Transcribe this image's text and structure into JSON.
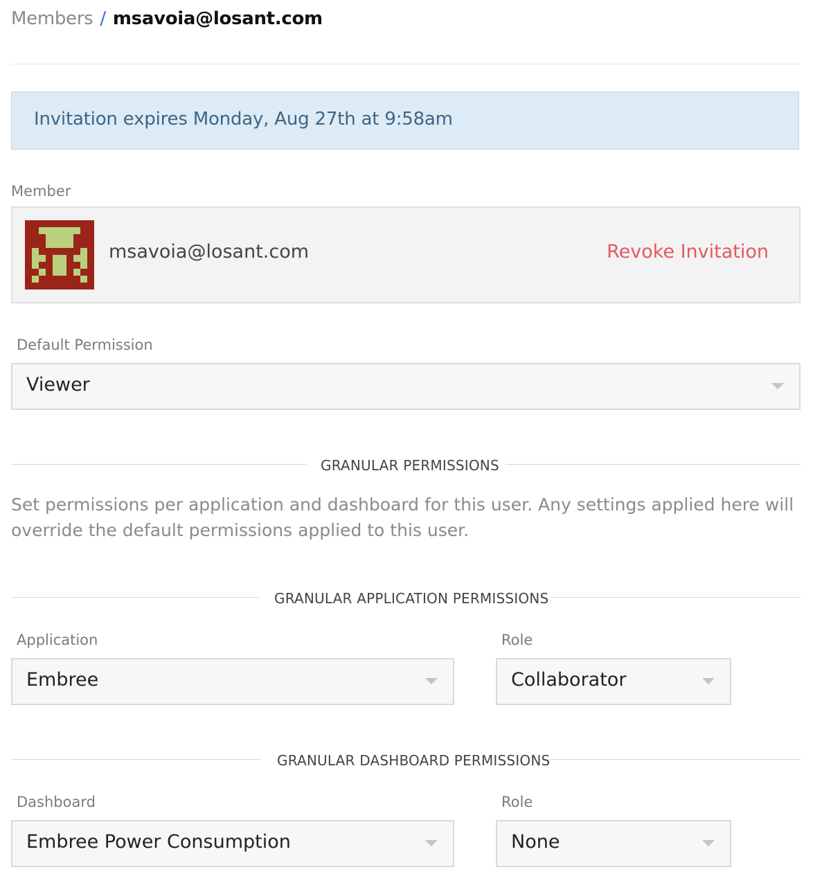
{
  "breadcrumb": {
    "parent": "Members",
    "separator": "/",
    "current": "msavoia@losant.com"
  },
  "alert": {
    "text": "Invitation expires Monday, Aug 27th at 9:58am"
  },
  "member": {
    "label": "Member",
    "email": "msavoia@losant.com",
    "revoke_label": "Revoke Invitation"
  },
  "default_permission": {
    "label": "Default Permission",
    "value": "Viewer"
  },
  "granular": {
    "heading": "GRANULAR PERMISSIONS",
    "description": "Set permissions per application and dashboard for this user. Any settings applied here will override the default permissions applied to this user."
  },
  "application_permissions": {
    "heading": "GRANULAR APPLICATION PERMISSIONS",
    "application_label": "Application",
    "application_value": "Embree",
    "role_label": "Role",
    "role_value": "Collaborator"
  },
  "dashboard_permissions": {
    "heading": "GRANULAR DASHBOARD PERMISSIONS",
    "dashboard_label": "Dashboard",
    "dashboard_value": "Embree Power Consumption",
    "role_label": "Role",
    "role_value": "None"
  },
  "colors": {
    "link_blue": "#3b6fd1",
    "alert_bg": "#dcebf6",
    "alert_text": "#3f6584",
    "revoke_red": "#e25a5f",
    "avatar_bg": "#9a2418",
    "avatar_fg": "#b9d17f"
  },
  "icons": {
    "avatar": "identicon-avatar",
    "select_caret": "chevron-down-icon"
  }
}
